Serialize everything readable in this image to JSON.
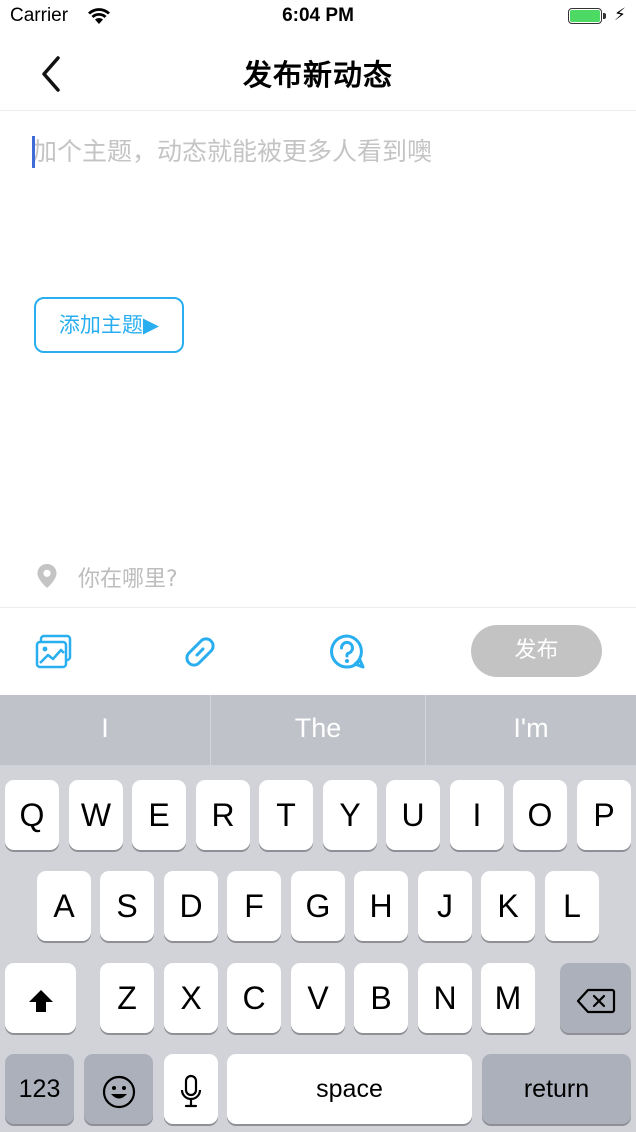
{
  "status_bar": {
    "carrier": "Carrier",
    "time": "6:04 PM"
  },
  "nav": {
    "title": "发布新动态"
  },
  "composer": {
    "placeholder": "加个主题，动态就能被更多人看到噢",
    "add_topic_label": "添加主题▶"
  },
  "location": {
    "label": "你在哪里?"
  },
  "toolbar": {
    "publish_label": "发布",
    "icons": [
      "image-icon",
      "link-icon",
      "question-icon"
    ]
  },
  "keyboard": {
    "suggestions": [
      "I",
      "The",
      "I'm"
    ],
    "row1": [
      "Q",
      "W",
      "E",
      "R",
      "T",
      "Y",
      "U",
      "I",
      "O",
      "P"
    ],
    "row2": [
      "A",
      "S",
      "D",
      "F",
      "G",
      "H",
      "J",
      "K",
      "L"
    ],
    "row3": [
      "Z",
      "X",
      "C",
      "V",
      "B",
      "N",
      "M"
    ],
    "numbers_label": "123",
    "space_label": "space",
    "return_label": "return"
  },
  "colors": {
    "accent": "#29aef0",
    "publish_disabled": "#c3c3c3",
    "battery": "#4cd964",
    "keyboard_bg": "#d1d3d9"
  }
}
